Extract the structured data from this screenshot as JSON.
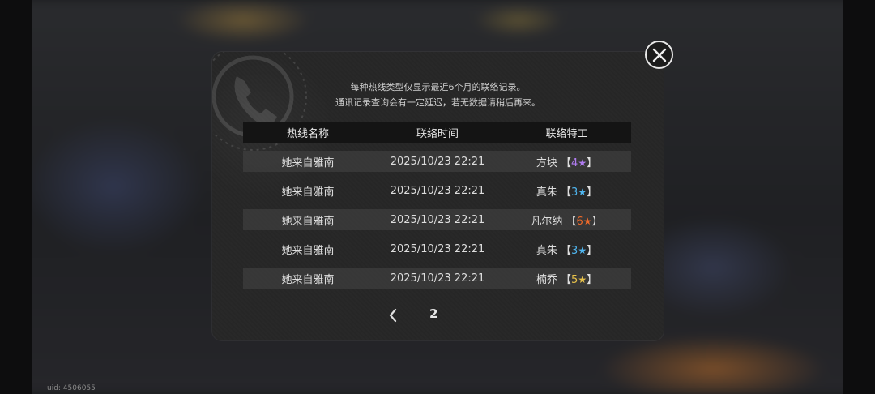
{
  "notice": {
    "line1": "每种热线类型仅显示最近6个月的联络记录。",
    "line2": "通讯记录查询会有一定延迟，若无数据请稍后再来。"
  },
  "table": {
    "headers": [
      "热线名称",
      "联络时间",
      "联络特工"
    ],
    "rows": [
      {
        "hotline": "她来自雅南",
        "time": "2025/10/23 22:21",
        "agent": "方块",
        "rank": "4",
        "star_color": "#b07cf0"
      },
      {
        "hotline": "她来自雅南",
        "time": "2025/10/23 22:21",
        "agent": "真朱",
        "rank": "3",
        "star_color": "#4fb6f0"
      },
      {
        "hotline": "她来自雅南",
        "time": "2025/10/23 22:21",
        "agent": "凡尔纳",
        "rank": "6",
        "star_color": "#f06a2a"
      },
      {
        "hotline": "她来自雅南",
        "time": "2025/10/23 22:21",
        "agent": "真朱",
        "rank": "3",
        "star_color": "#4fb6f0"
      },
      {
        "hotline": "她来自雅南",
        "time": "2025/10/23 22:21",
        "agent": "楠乔",
        "rank": "5",
        "star_color": "#e8c24a"
      }
    ]
  },
  "pager": {
    "current_page": "2"
  },
  "uid": "uid: 4506055",
  "icons": {
    "close": "close-icon",
    "prev": "chevron-left-icon",
    "star": "star-icon",
    "decor": "phone-icon"
  }
}
